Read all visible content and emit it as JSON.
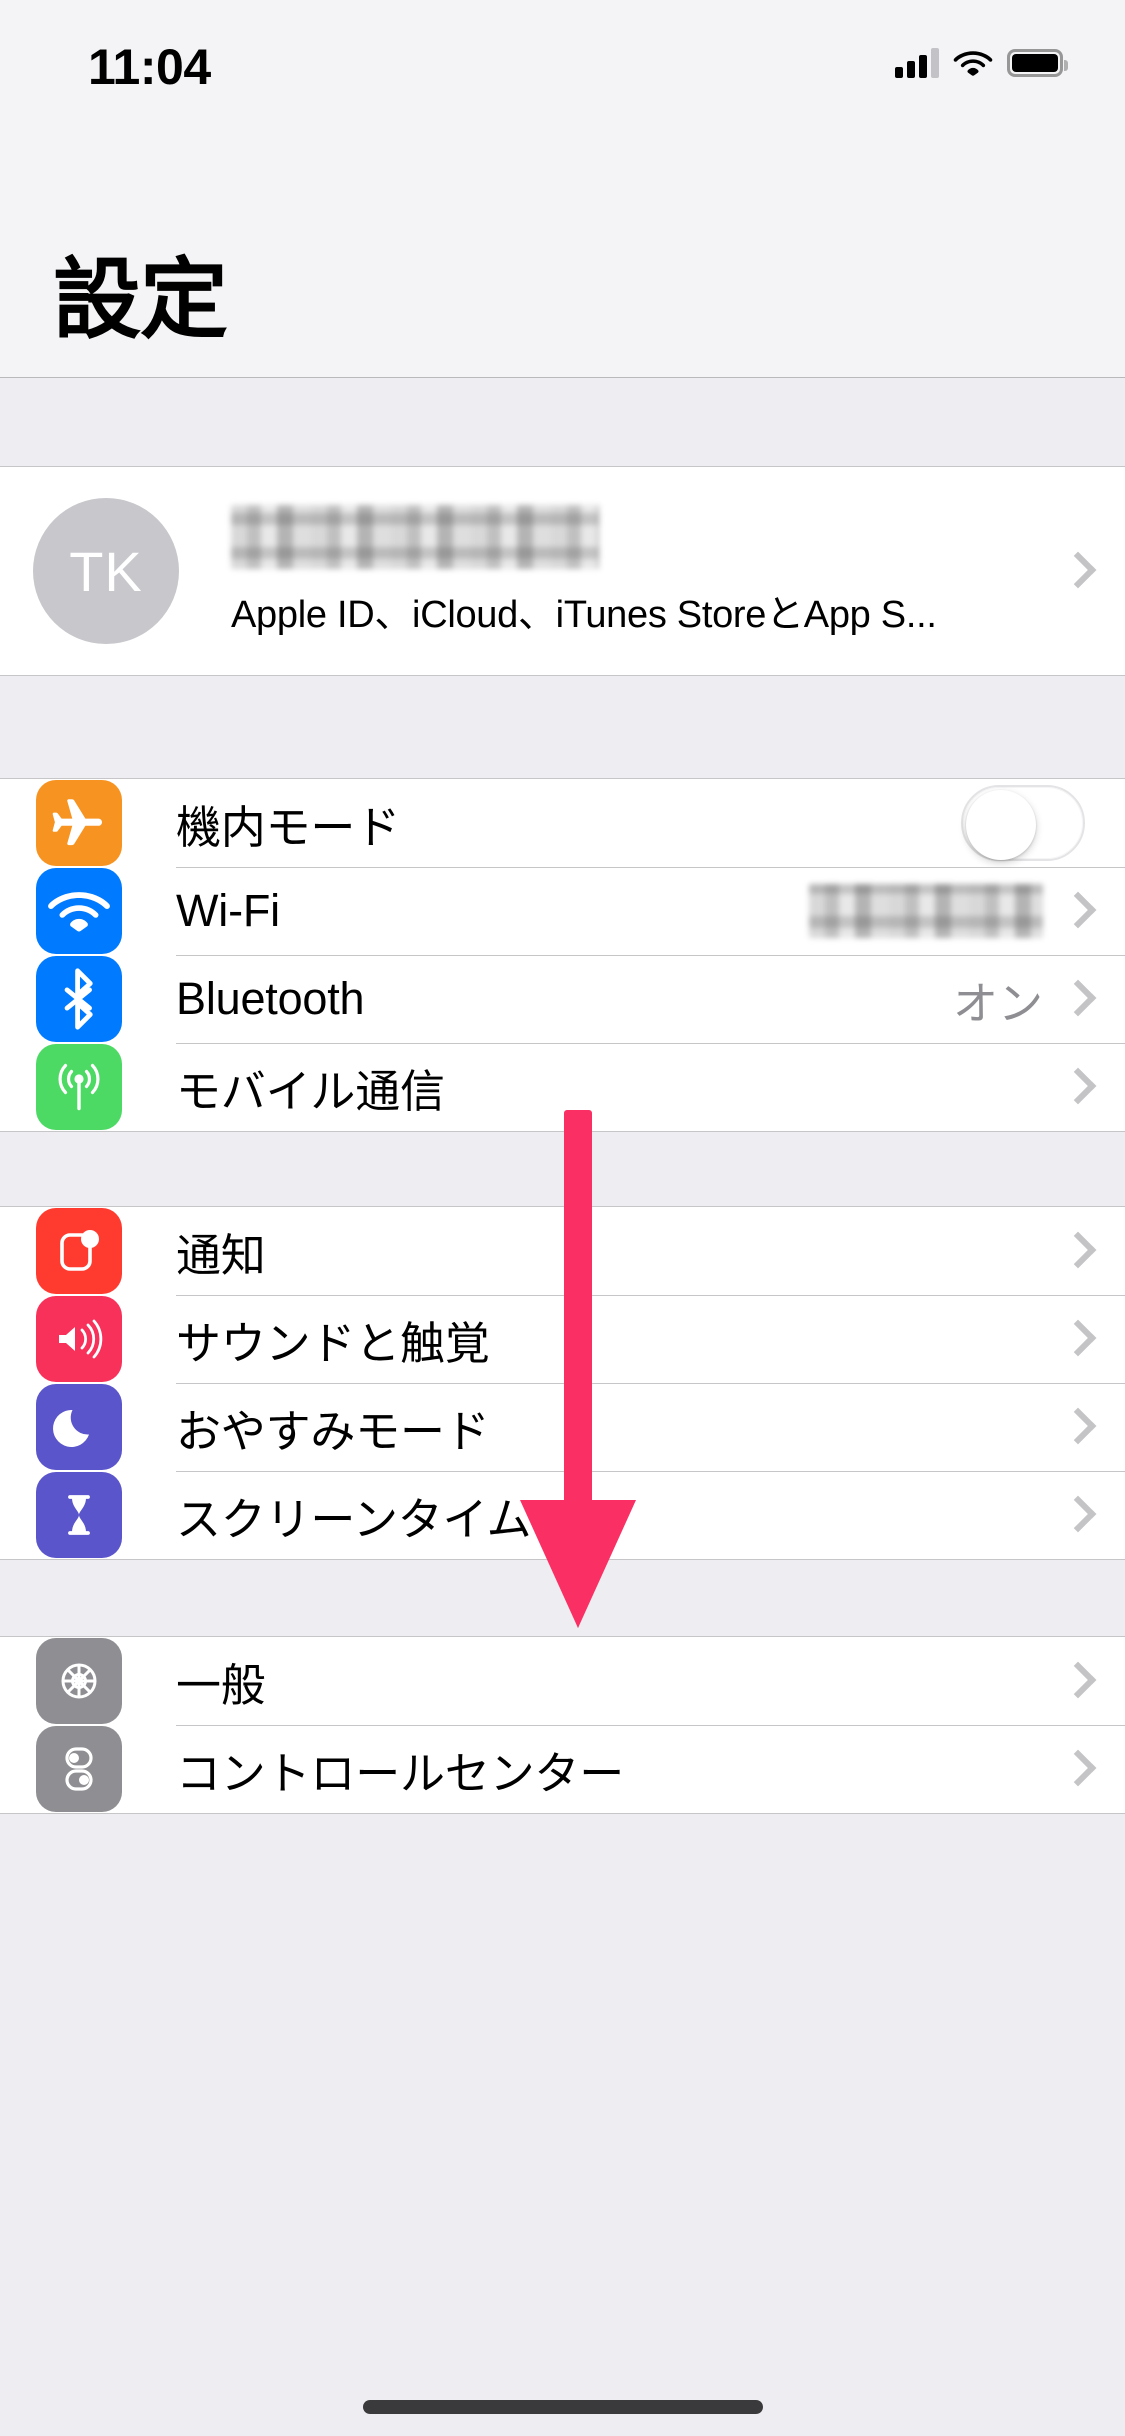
{
  "status_bar": {
    "time": "11:04",
    "signal_icon": "cellular-signal-icon",
    "wifi_icon": "wifi-icon",
    "battery_icon": "battery-full-icon",
    "signal_bars_filled": 3,
    "signal_bars_total": 4
  },
  "header": {
    "title": "設定"
  },
  "apple_id": {
    "avatar_initials": "TK",
    "name_redacted": true,
    "subtitle": "Apple ID、iCloud、iTunes StoreとApp S..."
  },
  "groups": [
    {
      "id": "connectivity",
      "rows": [
        {
          "label": "機内モード",
          "icon": "airplane-icon",
          "icon_color": "#f79321",
          "accessory": "toggle",
          "toggle_on": false,
          "value": ""
        },
        {
          "label": "Wi-Fi",
          "icon": "wifi-icon",
          "icon_color": "#007aff",
          "accessory": "value-chevron",
          "value_redacted": true,
          "value": ""
        },
        {
          "label": "Bluetooth",
          "icon": "bluetooth-icon",
          "icon_color": "#007aff",
          "accessory": "value-chevron",
          "value": "オン"
        },
        {
          "label": "モバイル通信",
          "icon": "cellular-antenna-icon",
          "icon_color": "#4cd964",
          "accessory": "chevron",
          "value": ""
        }
      ]
    },
    {
      "id": "alerts",
      "rows": [
        {
          "label": "通知",
          "icon": "notification-bell-icon",
          "icon_color": "#ff3b30",
          "accessory": "chevron",
          "value": ""
        },
        {
          "label": "サウンドと触覚",
          "icon": "speaker-icon",
          "icon_color": "#f8315a",
          "accessory": "chevron",
          "value": ""
        },
        {
          "label": "おやすみモード",
          "icon": "moon-icon",
          "icon_color": "#5a55ca",
          "accessory": "chevron",
          "value": ""
        },
        {
          "label": "スクリーンタイム",
          "icon": "hourglass-icon",
          "icon_color": "#5a55ca",
          "accessory": "chevron",
          "value": ""
        }
      ]
    },
    {
      "id": "system",
      "rows": [
        {
          "label": "一般",
          "icon": "gear-icon",
          "icon_color": "#8e8e93",
          "accessory": "chevron",
          "value": ""
        },
        {
          "label": "コントロールセンター",
          "icon": "sliders-icon",
          "icon_color": "#8e8e93",
          "accessory": "chevron",
          "value": ""
        }
      ]
    }
  ],
  "annotation": {
    "type": "arrow-down",
    "color": "#fa2f63",
    "description": "scroll-down-arrow"
  },
  "colors": {
    "background": "#eeeef2",
    "header_background": "#f4f4f6",
    "row_background": "#ffffff",
    "separator": "#c6c6c8",
    "secondary_text": "#8e8e93"
  }
}
